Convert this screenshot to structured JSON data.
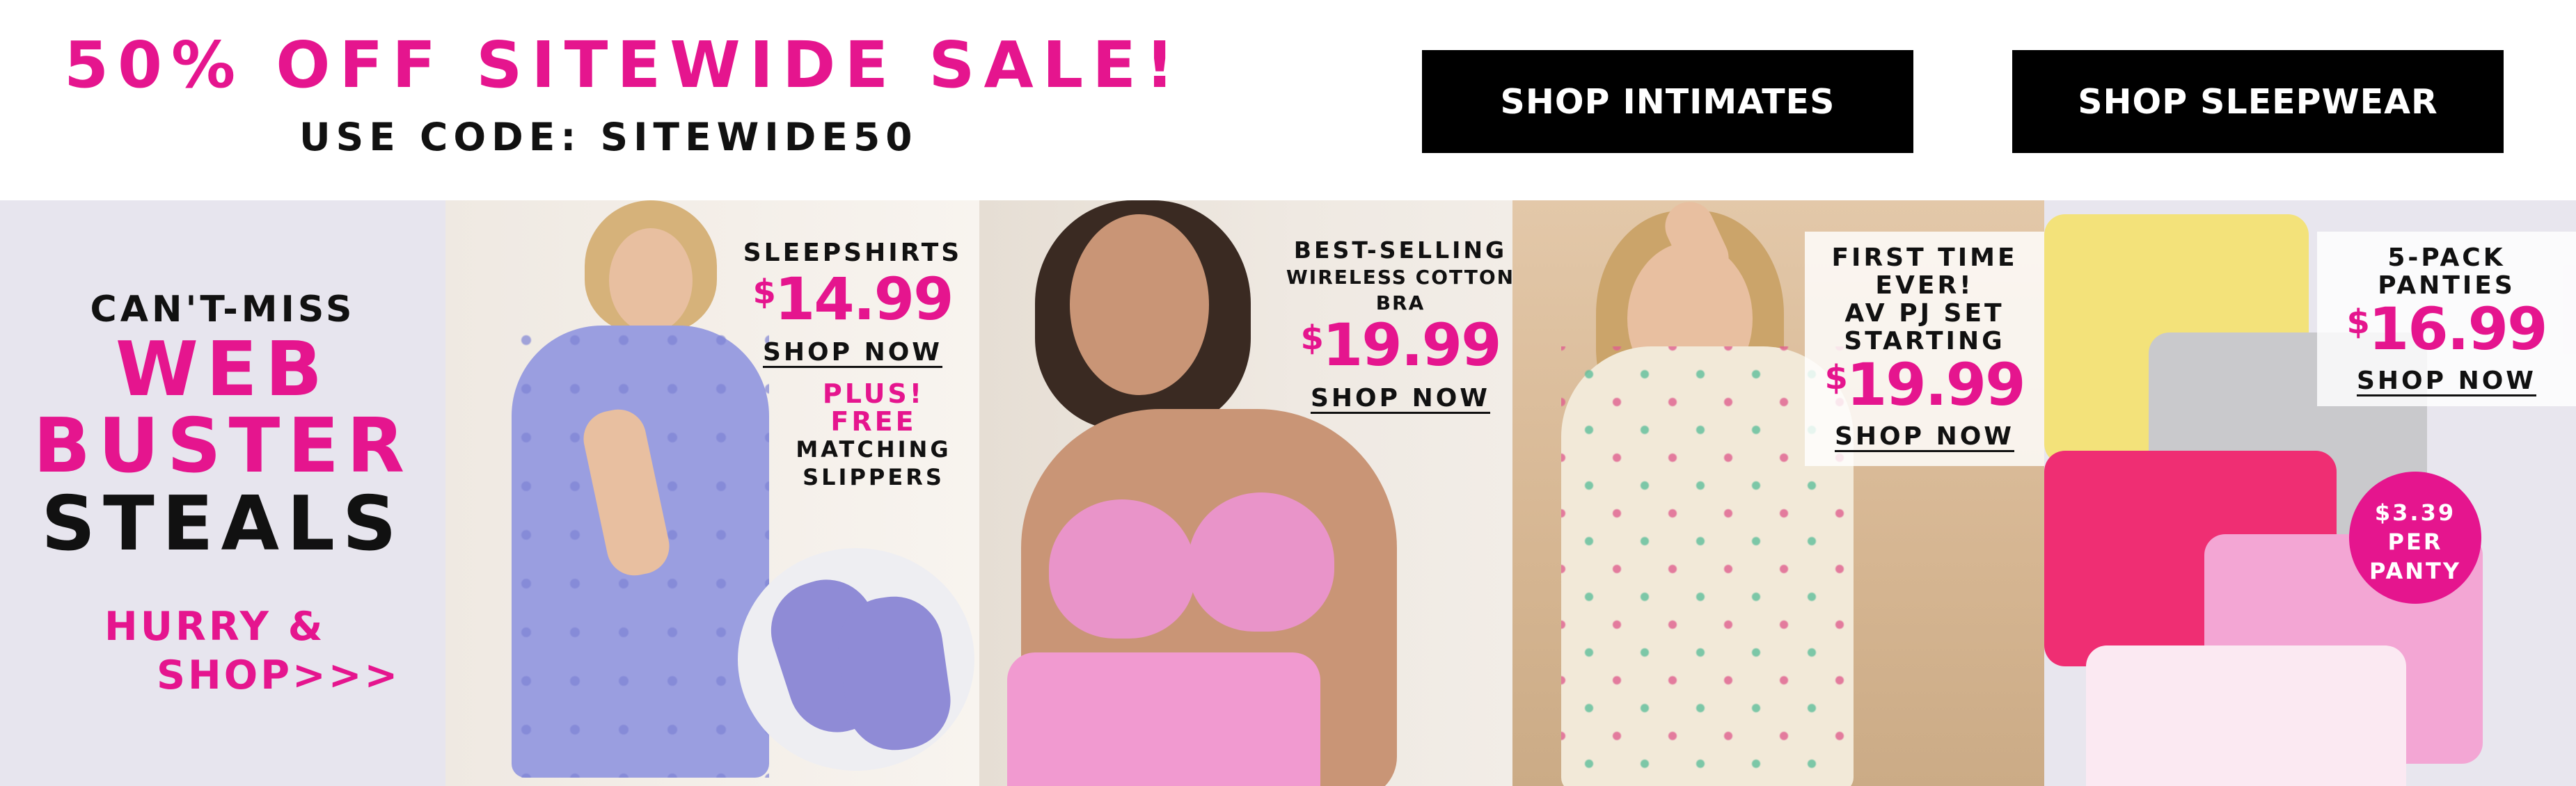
{
  "banner": {
    "headline": "50% OFF SITEWIDE SALE!",
    "code_line": "USE CODE: SITEWIDE50",
    "buttons": [
      {
        "label": "SHOP INTIMATES"
      },
      {
        "label": "SHOP SLEEPWEAR"
      }
    ]
  },
  "intro": {
    "kicker": "CAN'T-MISS",
    "line1": "WEB",
    "line2": "BUSTER",
    "line3": "STEALS",
    "cta_line1": "HURRY &",
    "cta_line2": "SHOP>>>"
  },
  "panels": [
    {
      "label": "SLEEPSHIRTS",
      "price_symbol": "$",
      "price": "14.99",
      "shop_now": "SHOP NOW",
      "promo": [
        "PLUS!",
        "FREE",
        "MATCHING",
        "SLIPPERS"
      ]
    },
    {
      "label_lines": [
        "BEST-SELLING",
        "WIRELESS COTTON",
        "BRA"
      ],
      "price_symbol": "$",
      "price": "19.99",
      "shop_now": "SHOP NOW"
    },
    {
      "label_lines": [
        "FIRST TIME",
        "EVER!",
        "AV PJ SET",
        "STARTING"
      ],
      "price_symbol": "$",
      "price": "19.99",
      "shop_now": "SHOP NOW"
    },
    {
      "label_lines": [
        "5-PACK",
        "PANTIES"
      ],
      "price_symbol": "$",
      "price": "16.99",
      "shop_now": "SHOP NOW",
      "badge": [
        "$3.39",
        "PER",
        "PANTY"
      ]
    }
  ],
  "colors": {
    "accent": "#e5158e",
    "text": "#111111",
    "button_bg": "#000000"
  }
}
